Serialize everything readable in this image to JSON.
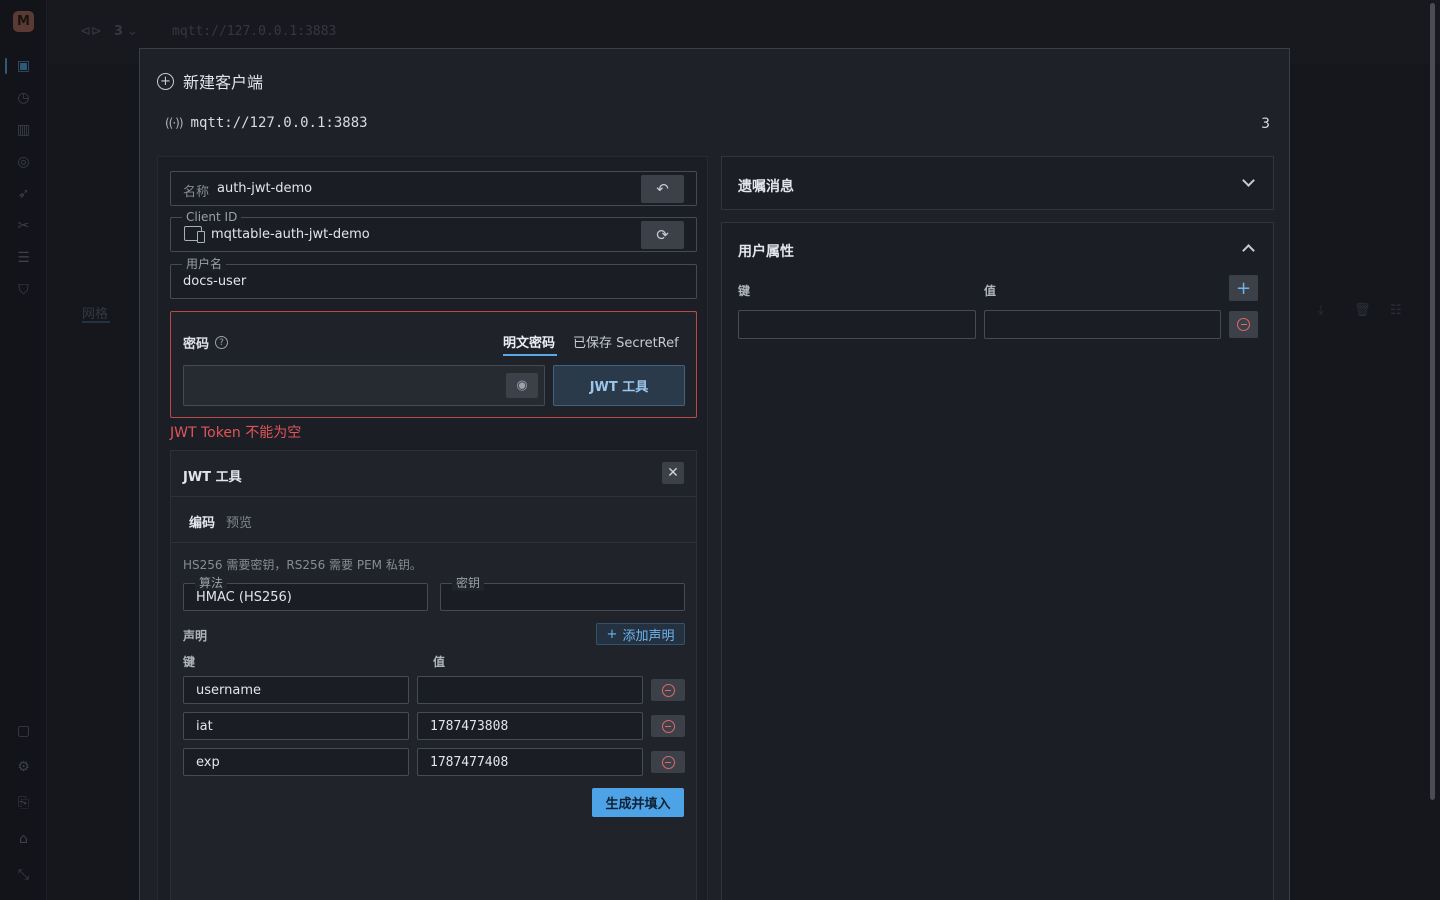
{
  "background": {
    "logo_letter": "M",
    "top_count": "3",
    "top_url": "mqtt://127.0.0.1:3883",
    "tab_1": "网格"
  },
  "modal": {
    "title": "新建客户端",
    "url": "mqtt://127.0.0.1:3883",
    "count": "3"
  },
  "form": {
    "name_label": "名称",
    "name_value": "auth-jwt-demo",
    "client_id_label": "Client ID",
    "client_id_value": "mqttable-auth-jwt-demo",
    "username_label": "用户名",
    "username_value": "docs-user",
    "password_label": "密码",
    "password_tab_plain": "明文密码",
    "password_tab_secret": "已保存 SecretRef",
    "password_value": "",
    "jwt_button": "JWT 工具",
    "error": "JWT Token 不能为空"
  },
  "jwt": {
    "title": "JWT 工具",
    "tab_encode": "编码",
    "tab_preview": "预览",
    "hint": "HS256 需要密钥，RS256 需要 PEM 私钥。",
    "algorithm_label": "算法",
    "algorithm_value": "HMAC (HS256)",
    "secret_label": "密钥",
    "secret_value": "",
    "claims_label": "声明",
    "add_claim": "添加声明",
    "key_header": "键",
    "value_header": "值",
    "claims": [
      {
        "key": "username",
        "value": ""
      },
      {
        "key": "iat",
        "value": "1787473808"
      },
      {
        "key": "exp",
        "value": "1787477408"
      }
    ],
    "generate_button": "生成并填入"
  },
  "will": {
    "title": "遗嘱消息"
  },
  "user_props": {
    "title": "用户属性",
    "key_header": "键",
    "value_header": "值"
  },
  "colors": {
    "accent": "#4da3e6",
    "error": "#e0545a",
    "background": "#15171c",
    "modal": "#1e2128"
  }
}
